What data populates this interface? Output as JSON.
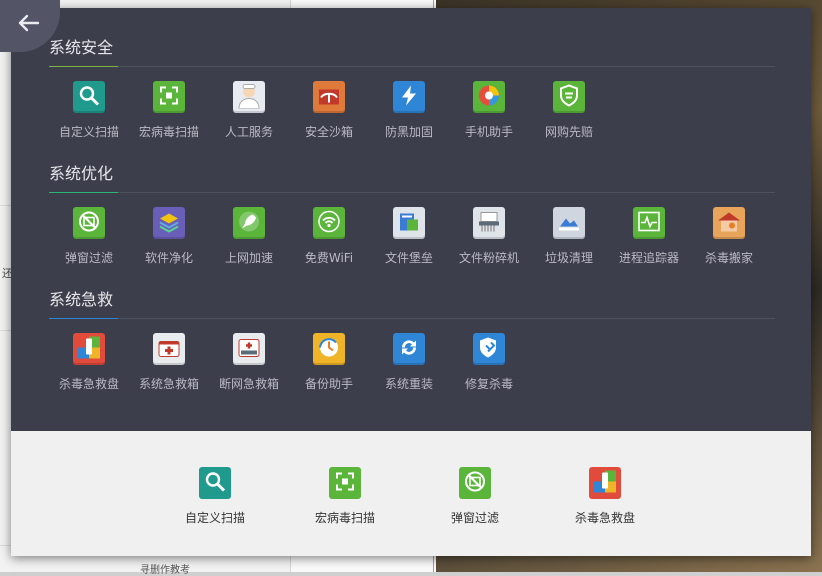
{
  "background": {
    "left_fragment": "还",
    "bottom_fragment": "寻删作教考"
  },
  "sections": [
    {
      "title": "系统安全",
      "accent": "#7cb342",
      "items": [
        {
          "label": "自定义扫描",
          "icon": "magnifier-icon",
          "color": "#1f9a8c"
        },
        {
          "label": "宏病毒扫描",
          "icon": "macro-scan-icon",
          "color": "#5bb53b"
        },
        {
          "label": "人工服务",
          "icon": "service-agent-icon",
          "color": "#e8ecf2"
        },
        {
          "label": "安全沙箱",
          "icon": "sandbox-icon",
          "color": "#e07a3a"
        },
        {
          "label": "防黑加固",
          "icon": "lightning-shield-icon",
          "color": "#2f86d6"
        },
        {
          "label": "手机助手",
          "icon": "phone-assistant-icon",
          "color": "#5bb53b"
        },
        {
          "label": "网购先赔",
          "icon": "shopping-shield-icon",
          "color": "#5bb53b"
        }
      ]
    },
    {
      "title": "系统优化",
      "accent": "#2bb673",
      "items": [
        {
          "label": "弹窗过滤",
          "icon": "popup-filter-icon",
          "color": "#5bb53b"
        },
        {
          "label": "软件净化",
          "icon": "layers-icon",
          "color": "#6a5fb8"
        },
        {
          "label": "上网加速",
          "icon": "rocket-icon",
          "color": "#5bb53b"
        },
        {
          "label": "免费WiFi",
          "icon": "wifi-icon",
          "color": "#5bb53b"
        },
        {
          "label": "文件堡垒",
          "icon": "file-fortress-icon",
          "color": "#dfe3ea"
        },
        {
          "label": "文件粉碎机",
          "icon": "shredder-icon",
          "color": "#dfe3ea"
        },
        {
          "label": "垃圾清理",
          "icon": "cleanup-icon",
          "color": "#cfd6df"
        },
        {
          "label": "进程追踪器",
          "icon": "process-monitor-icon",
          "color": "#5bb53b"
        },
        {
          "label": "杀毒搬家",
          "icon": "house-icon",
          "color": "#e8a45a"
        }
      ]
    },
    {
      "title": "系统急救",
      "accent": "#2f86d6",
      "items": [
        {
          "label": "杀毒急救盘",
          "icon": "usb-rescue-icon",
          "color": "#e04b3c"
        },
        {
          "label": "系统急救箱",
          "icon": "first-aid-icon",
          "color": "#e9ecef"
        },
        {
          "label": "断网急救箱",
          "icon": "network-aid-icon",
          "color": "#e9ecef"
        },
        {
          "label": "备份助手",
          "icon": "backup-icon",
          "color": "#f0b429"
        },
        {
          "label": "系统重装",
          "icon": "reinstall-icon",
          "color": "#2f86d6"
        },
        {
          "label": "修复杀毒",
          "icon": "repair-icon",
          "color": "#2f86d6"
        }
      ]
    }
  ],
  "quick": [
    {
      "label": "自定义扫描",
      "icon": "magnifier-icon",
      "color": "#1f9a8c"
    },
    {
      "label": "宏病毒扫描",
      "icon": "macro-scan-icon",
      "color": "#5bb53b"
    },
    {
      "label": "弹窗过滤",
      "icon": "popup-filter-icon",
      "color": "#5bb53b"
    },
    {
      "label": "杀毒急救盘",
      "icon": "usb-rescue-icon",
      "color": "#e04b3c"
    }
  ]
}
